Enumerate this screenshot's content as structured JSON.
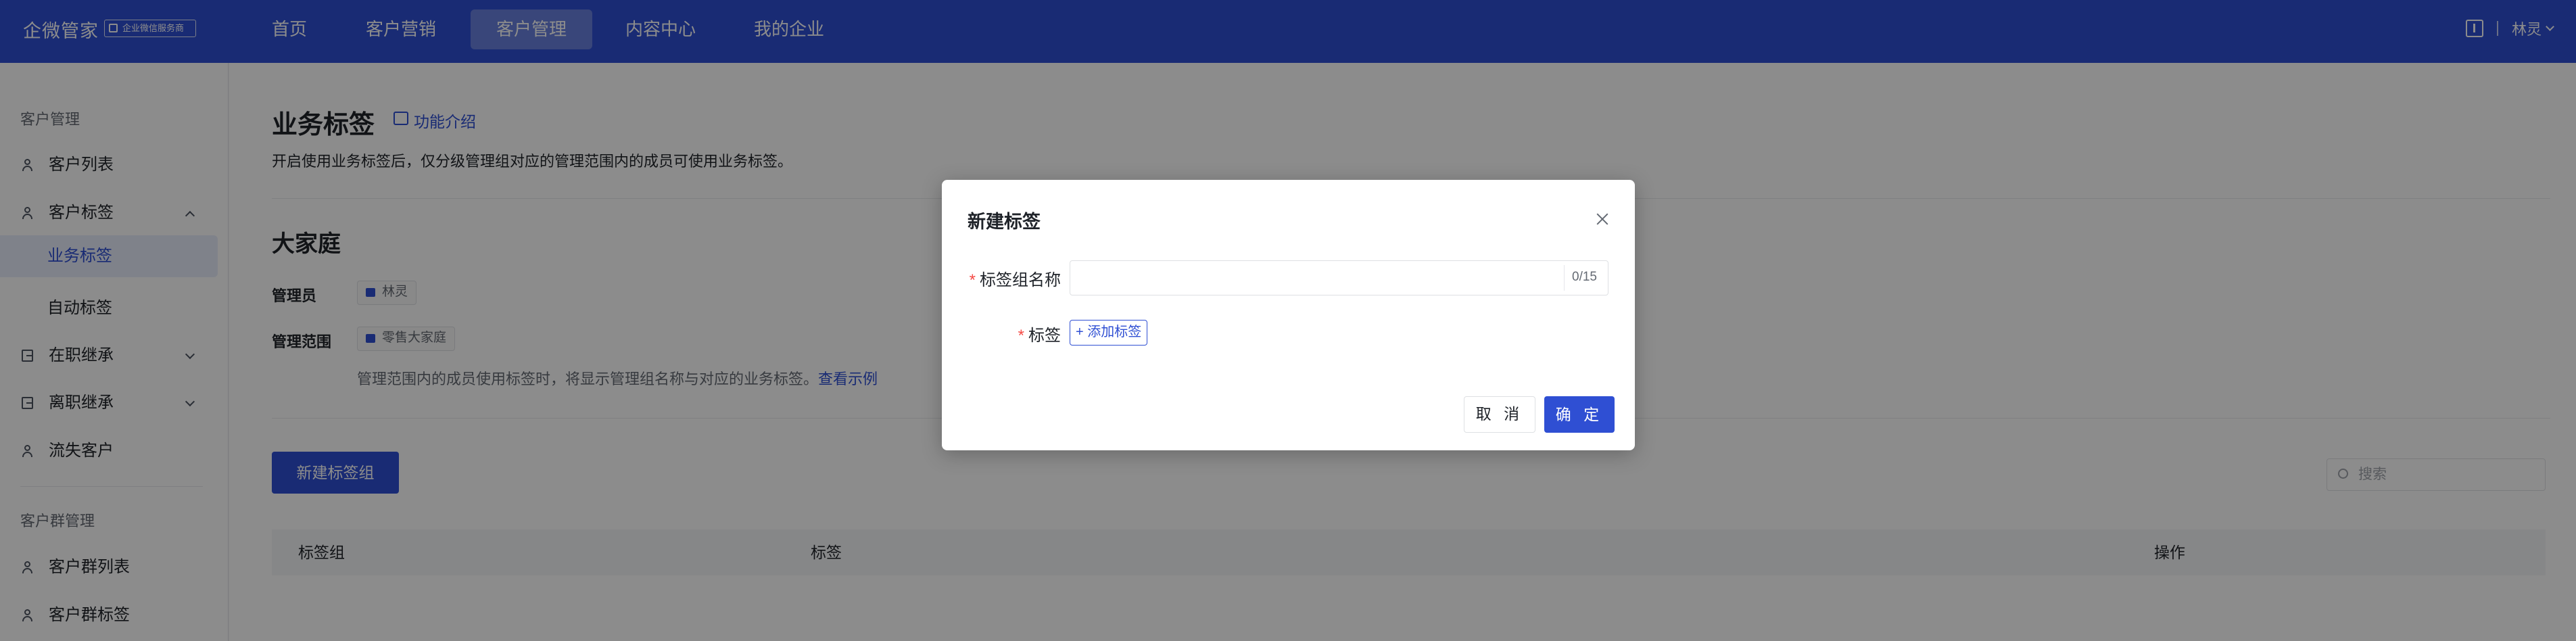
{
  "app": {
    "name": "企微管家",
    "badge": "企业微信服务商"
  },
  "nav": {
    "tabs": [
      {
        "label": "首页"
      },
      {
        "label": "客户营销"
      },
      {
        "label": "客户管理",
        "active": true
      },
      {
        "label": "内容中心"
      },
      {
        "label": "我的企业"
      }
    ]
  },
  "user": {
    "name": "林灵"
  },
  "sidebar": {
    "group1": "客户管理",
    "items": [
      {
        "label": "客户列表",
        "icon": "user-icon"
      },
      {
        "label": "客户标签",
        "icon": "user-icon",
        "expanded": true
      },
      {
        "label": "业务标签",
        "active": true
      },
      {
        "label": "自动标签"
      },
      {
        "label": "在职继承",
        "icon": "transfer-icon"
      },
      {
        "label": "离职继承",
        "icon": "transfer-icon"
      },
      {
        "label": "流失客户",
        "icon": "user-icon"
      }
    ],
    "group2": "客户群管理",
    "group_items": [
      {
        "label": "客户群列表",
        "icon": "group-icon"
      },
      {
        "label": "客户群标签",
        "icon": "group-icon"
      }
    ]
  },
  "page": {
    "title": "业务标签",
    "intro_link": "功能介绍",
    "description": "开启使用业务标签后，仅分级管理组对应的管理范围内的成员可使用业务标签。",
    "group_title": "大家庭",
    "admin_label": "管理员",
    "admin_value": "林灵",
    "scope_label": "管理范围",
    "scope_value": "零售大家庭",
    "scope_note": "管理范围内的成员使用标签时，将显示管理组名称与对应的业务标签。",
    "scope_example_link": "查看示例",
    "new_group_button": "新建标签组",
    "search_placeholder": "搜索",
    "table_headers": [
      "标签组",
      "标签",
      "操作"
    ]
  },
  "modal": {
    "title": "新建标签",
    "required_mark": "*",
    "group_name_label": "标签组名称",
    "group_name_value": "",
    "group_name_count": "0/15",
    "tag_label": "标签",
    "add_tag_button": "+ 添加标签",
    "cancel_button": "取 消",
    "confirm_button": "确 定"
  },
  "colors": {
    "primary": "#2f4fd3",
    "required": "#f54a45"
  }
}
